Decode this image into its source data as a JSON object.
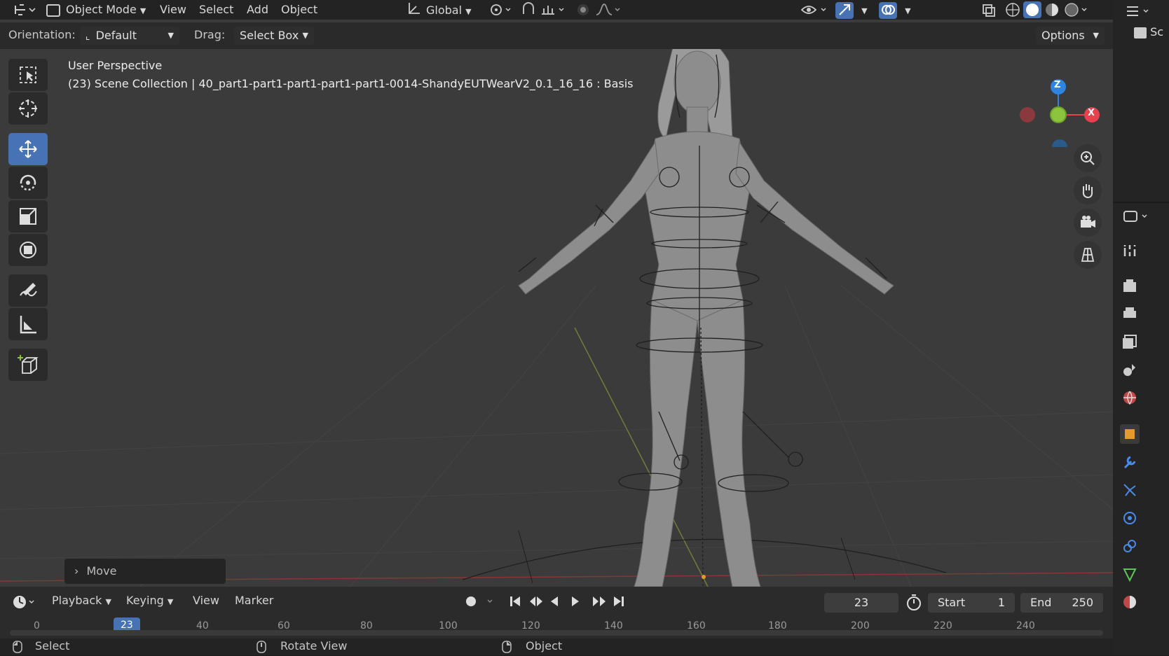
{
  "header": {
    "mode": "Object Mode",
    "menus": [
      "View",
      "Select",
      "Add",
      "Object"
    ],
    "transform_orientation": "Global"
  },
  "tool_settings": {
    "orientation_label": "Orientation:",
    "orientation_value": "Default",
    "drag_label": "Drag:",
    "drag_value": "Select Box",
    "options_label": "Options"
  },
  "viewport": {
    "view_name": "User Perspective",
    "collection_info": "(23) Scene Collection | 40_part1-part1-part1-part1-part1-0014-ShandyEUTWearV2_0.1_16_16 : Basis",
    "gizmo_axes": [
      "Z",
      "X"
    ],
    "last_operator": "Move"
  },
  "toolbar_tools": [
    "select-box",
    "cursor",
    "move",
    "rotate",
    "scale",
    "transform",
    "annotate",
    "measure",
    "add-cube"
  ],
  "nav_buttons": [
    "zoom-icon",
    "pan-hand-icon",
    "camera-icon",
    "perspective-grid-icon"
  ],
  "timeline": {
    "menus": [
      "Playback",
      "Keying",
      "View",
      "Marker"
    ],
    "current_frame": "23",
    "start_label": "Start",
    "start_value": "1",
    "end_label": "End",
    "end_value": "250",
    "ruler_ticks": [
      "0",
      "23",
      "40",
      "60",
      "80",
      "100",
      "120",
      "140",
      "160",
      "180",
      "200",
      "220",
      "240"
    ]
  },
  "statusbar": {
    "items": [
      "Select",
      "Rotate View",
      "Object"
    ]
  },
  "outliner_partial": [
    "Sc"
  ],
  "colors": {
    "accent": "#4772b3",
    "axis_x": "#e8414e",
    "axis_y": "#8cc43e",
    "axis_z": "#2f84e2"
  }
}
